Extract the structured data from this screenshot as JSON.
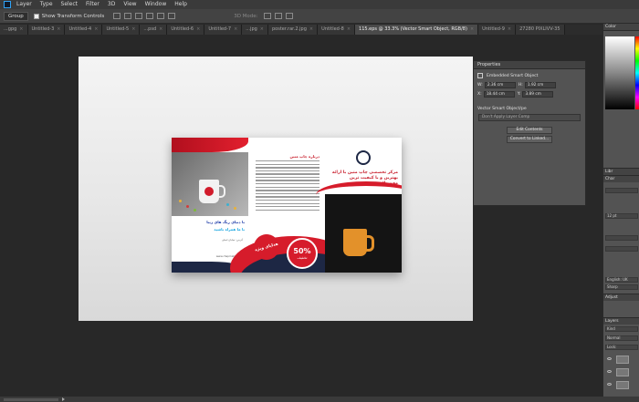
{
  "menu": [
    "Layer",
    "Type",
    "Select",
    "Filter",
    "3D",
    "View",
    "Window",
    "Help"
  ],
  "options": {
    "autoselect": "Group",
    "show_transform": "Show Transform Controls",
    "mode_3d": "3D Mode:"
  },
  "tabs": [
    {
      "label": "...gpg",
      "active": false
    },
    {
      "label": "Untitled-3",
      "active": false
    },
    {
      "label": "Untitled-4",
      "active": false
    },
    {
      "label": "Untitled-5",
      "active": false
    },
    {
      "label": "...psd",
      "active": false
    },
    {
      "label": "Untitled-6",
      "active": false
    },
    {
      "label": "Untitled-7",
      "active": false
    },
    {
      "label": "...jpg",
      "active": false
    },
    {
      "label": "poster.rar.2.jpg",
      "active": false
    },
    {
      "label": "Untitled-8",
      "active": false
    },
    {
      "label": "115.eps @ 33.3% (Vector Smart Object, RGB/8)",
      "active": true
    },
    {
      "label": "Untitled-9",
      "active": false
    },
    {
      "label": "27280 PIXLIVV-35",
      "active": false
    }
  ],
  "brochure": {
    "left_blue_1": "با دنیای رنگ های زیبا",
    "left_cyan_1": "با ما همراه باشید",
    "left_small_1": "آدرس: خیابان اصلی",
    "left_small_2": "www.chapmatin.com",
    "mid_heading": "درباره چاپ متین",
    "badge": "هدایای ویژه",
    "discount_pct": "50%",
    "discount_off": "تخفیف",
    "right_title": "مرکز تخصصی چاپ متین با ارائه بهترین و با کیفیت ترین محصولات"
  },
  "properties": {
    "header": "Properties",
    "object_type": "Embedded Smart Object",
    "w_label": "W:",
    "w_value": "2.36 cm",
    "h_label": "H:",
    "h_value": "1.92 cm",
    "x_label": "X:",
    "x_value": "18.44 cm",
    "y_label": "Y:",
    "y_value": "3.89 cm",
    "vso_label": "Vector Smart Object/pe",
    "comp_dropdown": "Don't Apply Layer Comp",
    "edit_button": "Edit Contents",
    "convert_button": "Convert to Linked..."
  },
  "dock": {
    "color_header": "Color",
    "libraries": "Libr",
    "adjust": "Adjust",
    "color_swatch": "Color",
    "layers": "Layers",
    "kind": "Kind",
    "normal": "Normal",
    "lock": "Lock:",
    "font_size": "12 pt",
    "lang": "English: UK",
    "sharp": "Sharp",
    "char_header": "Char"
  }
}
